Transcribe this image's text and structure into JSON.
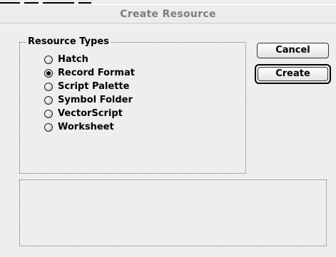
{
  "window": {
    "title": "Create Resource"
  },
  "resource_types": {
    "label": "Resource Types",
    "selected": "Record Format",
    "options": [
      {
        "label": "Hatch",
        "checked": false
      },
      {
        "label": "Record Format",
        "checked": true
      },
      {
        "label": "Script Palette",
        "checked": false
      },
      {
        "label": "Symbol Folder",
        "checked": false
      },
      {
        "label": "VectorScript",
        "checked": false
      },
      {
        "label": "Worksheet",
        "checked": false
      }
    ]
  },
  "buttons": {
    "cancel": "Cancel",
    "create": "Create"
  },
  "description": {
    "text": ""
  }
}
